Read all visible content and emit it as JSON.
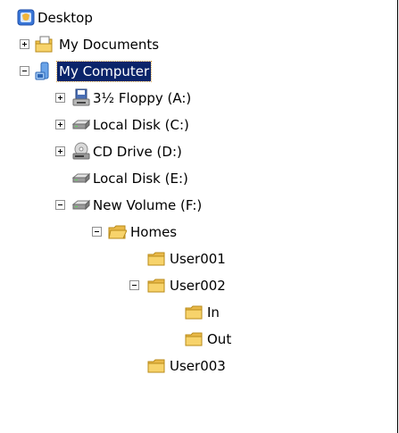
{
  "tree": {
    "items": [
      {
        "label": "Desktop",
        "icon": "desktop-icon",
        "expander": "none"
      },
      {
        "label": "My Documents",
        "icon": "documents-folder-icon",
        "expander": "plus"
      },
      {
        "label": "My Computer",
        "icon": "computer-icon",
        "expander": "minus",
        "selected": true
      },
      {
        "label": "3½ Floppy (A:)",
        "icon": "floppy-drive-icon",
        "expander": "plus"
      },
      {
        "label": "Local Disk (C:)",
        "icon": "hard-disk-icon",
        "expander": "plus"
      },
      {
        "label": "CD Drive (D:)",
        "icon": "cd-drive-icon",
        "expander": "plus"
      },
      {
        "label": "Local Disk (E:)",
        "icon": "hard-disk-icon",
        "expander": "none"
      },
      {
        "label": "New Volume (F:)",
        "icon": "hard-disk-icon",
        "expander": "minus"
      },
      {
        "label": "Homes",
        "icon": "folder-open-icon",
        "expander": "minus"
      },
      {
        "label": "User001",
        "icon": "folder-icon",
        "expander": "none"
      },
      {
        "label": "User002",
        "icon": "folder-icon",
        "expander": "minus"
      },
      {
        "label": "In",
        "icon": "folder-icon",
        "expander": "none"
      },
      {
        "label": "Out",
        "icon": "folder-icon",
        "expander": "none"
      },
      {
        "label": "User003",
        "icon": "folder-icon",
        "expander": "none"
      }
    ]
  },
  "colors": {
    "selection_bg": "#0a246a",
    "selection_text": "#ffffff",
    "folder_yellow": "#f7d36b"
  }
}
